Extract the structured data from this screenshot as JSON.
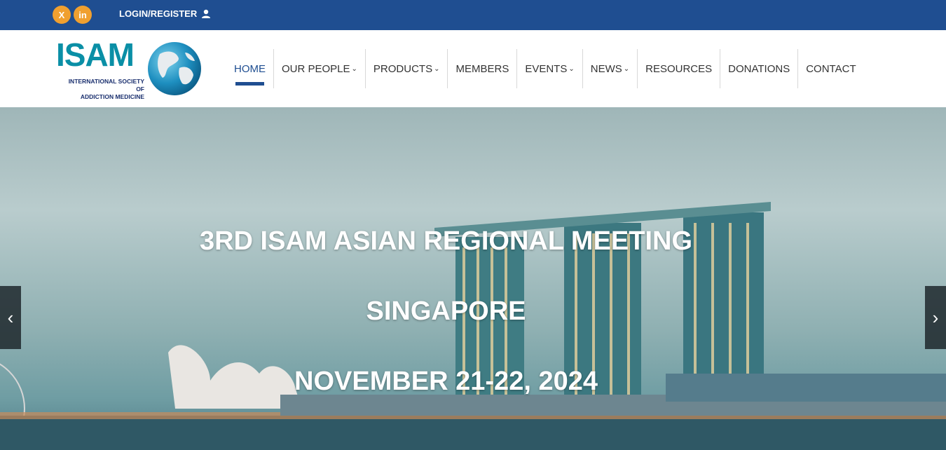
{
  "topbar": {
    "social": [
      {
        "label": "X",
        "icon": "x-twitter-icon"
      },
      {
        "label": "in",
        "icon": "linkedin-icon"
      }
    ],
    "login_label": "LOGIN/REGISTER"
  },
  "logo": {
    "title": "ISAM",
    "subtitle_line1": "INTERNATIONAL SOCIETY OF",
    "subtitle_line2": "ADDICTION MEDICINE"
  },
  "nav": {
    "items": [
      {
        "label": "HOME",
        "active": true,
        "dropdown": false
      },
      {
        "label": "OUR PEOPLE",
        "dropdown": true
      },
      {
        "label": "PRODUCTS",
        "dropdown": true
      },
      {
        "label": "MEMBERS",
        "dropdown": false
      },
      {
        "label": "EVENTS",
        "dropdown": true
      },
      {
        "label": "NEWS",
        "dropdown": true
      },
      {
        "label": "RESOURCES",
        "dropdown": false
      },
      {
        "label": "DONATIONS",
        "dropdown": false
      },
      {
        "label": "CONTACT",
        "dropdown": false
      }
    ]
  },
  "hero": {
    "line1": "3RD ISAM ASIAN REGIONAL MEETING",
    "line2": "SINGAPORE",
    "line3": "NOVEMBER 21-22, 2024"
  },
  "colors": {
    "topbar": "#1f4e91",
    "accent": "#f0a030",
    "logo": "#0a8fa6"
  }
}
